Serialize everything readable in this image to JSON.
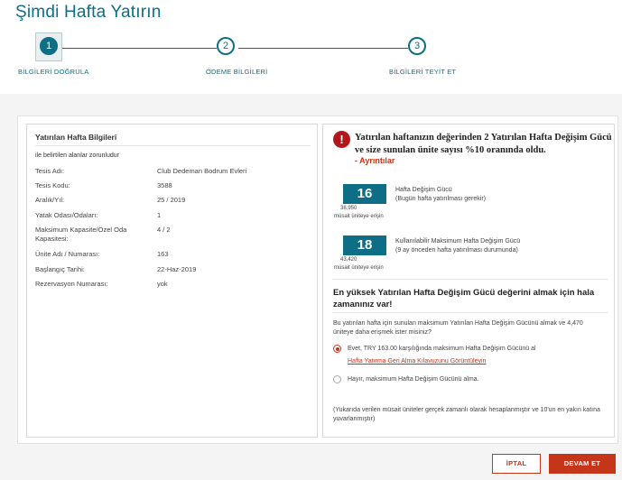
{
  "page": {
    "title": "Şimdi Hafta Yatırın"
  },
  "stepper": {
    "steps": [
      {
        "number": "1",
        "label": "BİLGİLERİ DOĞRULA",
        "active": true
      },
      {
        "number": "2",
        "label": "ÖDEME BİLGİLERİ",
        "active": false
      },
      {
        "number": "3",
        "label": "BİLGİLERİ TEYİT ET",
        "active": false
      }
    ],
    "color": "#0e6e85"
  },
  "info": {
    "title": "Yatırılan Hafta Bilgileri",
    "required_note": "ile belirtilen alanlar zorunludur",
    "rows": [
      {
        "key": "Tesis Adı:",
        "value": "Club Dedeman Bodrum Evleri"
      },
      {
        "key": "Tesis Kodu:",
        "value": "3588"
      },
      {
        "key": "Aralık/Yıl:",
        "value": "25 / 2019"
      },
      {
        "key": "Yatak Odası/Odaları:",
        "value": "1"
      },
      {
        "key": "Maksimum Kapasite/Özel Oda Kapasitesi:",
        "value": "4 / 2"
      },
      {
        "key": "Ünite Adı / Numarası:",
        "value": "163"
      },
      {
        "key": "Başlangıç Tarihi:",
        "value": "22-Haz-2019"
      },
      {
        "key": "Rezervasyon Numarası:",
        "value": "yok"
      }
    ]
  },
  "alert": {
    "icon": "exclamation-icon",
    "text": "Yatırılan haftanızın değerinden 2 Yatırılan Hafta Değişim Gücü ve size sunulan ünite sayısı %10 oranında oldu.",
    "link": "- Ayrıntılar",
    "color": "#b3171c"
  },
  "metrics": [
    {
      "value": "16",
      "sub_count": "38,950",
      "sub_text": "müsait üniteye erişin",
      "label_main": "Hafta Değişim Gücü",
      "label_detail": "(Bugün hafta yatırılması gerekir)"
    },
    {
      "value": "18",
      "sub_count": "43,420",
      "sub_text": "müsait üniteye erişin",
      "label_main": "Kullanılabilir Maksimum Hafta Değişim Gücü",
      "label_detail": "(9 ay önceden hafta yatırılması durumunda)"
    }
  ],
  "question": {
    "title": "En yüksek Yatırılan Hafta Değişim Gücü değerini almak için hala zamanınız var!",
    "description": "Bu yatırılan hafta için sunulan maksimum Yatırılan Hafta Değişim Gücünü almak ve 4,470 üniteye daha erişmek ister misiniz?",
    "option_yes": "Evet, TRY 163.00 karşılığında maksimum Hafta Değişim Gücünü al",
    "option_yes_link": "Hafta Yatırma Geri Alma Kılavuzunu Görüntüleyin",
    "option_no": "Hayır, maksimum Hafta Değişim Gücünü alma.",
    "selected": "yes"
  },
  "note": "(Yukarıda verilen müsait üniteler gerçek zamanlı olarak hesaplanmıştır ve 10'un en yakın katına yuvarlanmıştır)",
  "buttons": {
    "cancel": "İPTAL",
    "next": "DEVAM ET",
    "accent": "#c4351a"
  }
}
